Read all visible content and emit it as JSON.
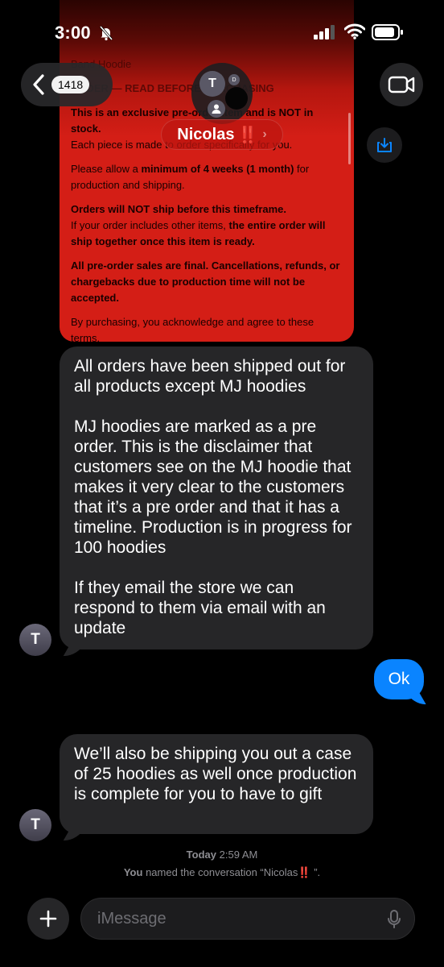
{
  "status_bar": {
    "time": "3:00"
  },
  "header": {
    "unread_count": "1418",
    "conversation_name": "Nicolas",
    "name_emoji": "‼️",
    "avatar_initial": "T",
    "avatar_small_initial": "D"
  },
  "screenshot_image": {
    "lines": [
      {
        "id": "p0",
        "text": "Band Hoodie"
      },
      {
        "id": "p1",
        "text": "ORDER — READ BEFORE PURCHASING"
      },
      {
        "id": "p2",
        "text": "This is an exclusive pre-order item and is NOT in stock."
      },
      {
        "id": "p3",
        "text": "Each piece is made to order specifically for you."
      },
      {
        "id": "p4a",
        "text": "Please allow a "
      },
      {
        "id": "p4b",
        "text": "minimum of 4 weeks (1 month)"
      },
      {
        "id": "p4c",
        "text": " for production and shipping."
      },
      {
        "id": "p5a",
        "text": "Orders will NOT ship before this timeframe."
      },
      {
        "id": "p5b",
        "text": "If your order includes other items, "
      },
      {
        "id": "p5c",
        "text": "the entire order will ship together once this item is ready."
      },
      {
        "id": "p6",
        "text": "All pre-order sales are final. Cancellations, refunds, or chargebacks due to production time will not be accepted."
      },
      {
        "id": "p7",
        "text": "By purchasing, you acknowledge and agree to these terms."
      }
    ]
  },
  "messages": [
    {
      "direction": "incoming",
      "paragraphs": [
        "All orders have been shipped out for all products except MJ hoodies",
        "MJ hoodies are marked as a pre order. This is the disclaimer that customers see on the MJ hoodie that makes it very clear to the customers that it’s a pre order and that it has a timeline. Production is in progress for 100 hoodies",
        "If they email the store we can respond to them via email with an update"
      ],
      "avatar": "T"
    },
    {
      "direction": "outgoing",
      "text": "Ok"
    },
    {
      "direction": "incoming",
      "text": "We’ll also be shipping you out a case of 25 hoodies as well once production is complete for you to have to gift",
      "avatar": "T"
    }
  ],
  "timestamp": {
    "day": "Today",
    "time": "2:59 AM"
  },
  "system_note": {
    "actor": "You",
    "text": "named the conversation “Nicolas",
    "emoji": "‼️",
    "suffix": " ”."
  },
  "composer": {
    "placeholder": "iMessage"
  },
  "icons": [
    "bell-slash-icon",
    "signal-icon",
    "wifi-icon",
    "battery-icon",
    "chevron-left-icon",
    "video-camera-icon",
    "save-download-icon",
    "plus-icon",
    "microphone-icon"
  ],
  "colors": {
    "outgoing_bubble": "#0a84ff",
    "incoming_bubble": "#262628",
    "accent_red": "#d41e16"
  }
}
